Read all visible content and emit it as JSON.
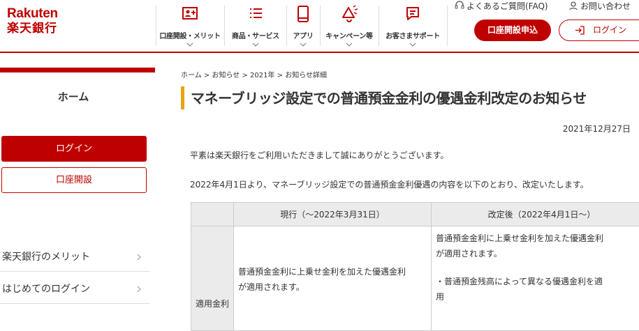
{
  "logo": {
    "en": "Rakuten",
    "jp": "楽天銀行"
  },
  "header": {
    "nav": [
      {
        "label": "口座開設・メリット",
        "icon": "account-add-icon"
      },
      {
        "label": "商品・サービス",
        "icon": "list-icon"
      },
      {
        "label": "アプリ",
        "icon": "smartphone-icon"
      },
      {
        "label": "キャンペーン等",
        "icon": "megaphone-icon"
      },
      {
        "label": "お客さまサポート",
        "icon": "chat-support-icon"
      }
    ],
    "faq": "よくあるご質問(FAQ)",
    "contact": "お問い合わせ",
    "open_account": "口座開設申込",
    "login": "ログイン"
  },
  "sidebar": {
    "home": "ホーム",
    "login": "ログイン",
    "open_account": "口座開設",
    "links": [
      "楽天銀行のメリット",
      "はじめてのログイン"
    ]
  },
  "breadcrumb": {
    "home": "ホーム",
    "sep": " > ",
    "news": "お知らせ",
    "year": "2021年",
    "detail": "お知らせ詳細"
  },
  "article": {
    "title": "マネーブリッジ設定での普通預金金利の優遇金利改定のお知らせ",
    "date": "2021年12月27日",
    "greeting": "平素は楽天銀行をご利用いただきまして誠にありがとうございます。",
    "intro": "2022年4月1日より、マネーブリッジ設定での普通預金金利優遇の内容を以下のとおり、改定いたします。"
  },
  "table": {
    "headers": [
      "",
      "現行（〜2022年3月31日）",
      "改定後（2022年4月1日〜）"
    ],
    "row_label": "適用金利",
    "current_line1": "普通預金金利に上乗せ金利を加えた優遇金利",
    "current_line2": "が適用されます。",
    "new_line1": "普通預金金利に上乗せ金利を加えた優遇金利",
    "new_line2": "が適用されます。",
    "new_line3": "・普通預金残高によって異なる優遇金利を適",
    "new_line4": "用"
  },
  "colors": {
    "brand": "#bf0000",
    "accent": "#e8a317",
    "table_header": "#ebebeb"
  }
}
